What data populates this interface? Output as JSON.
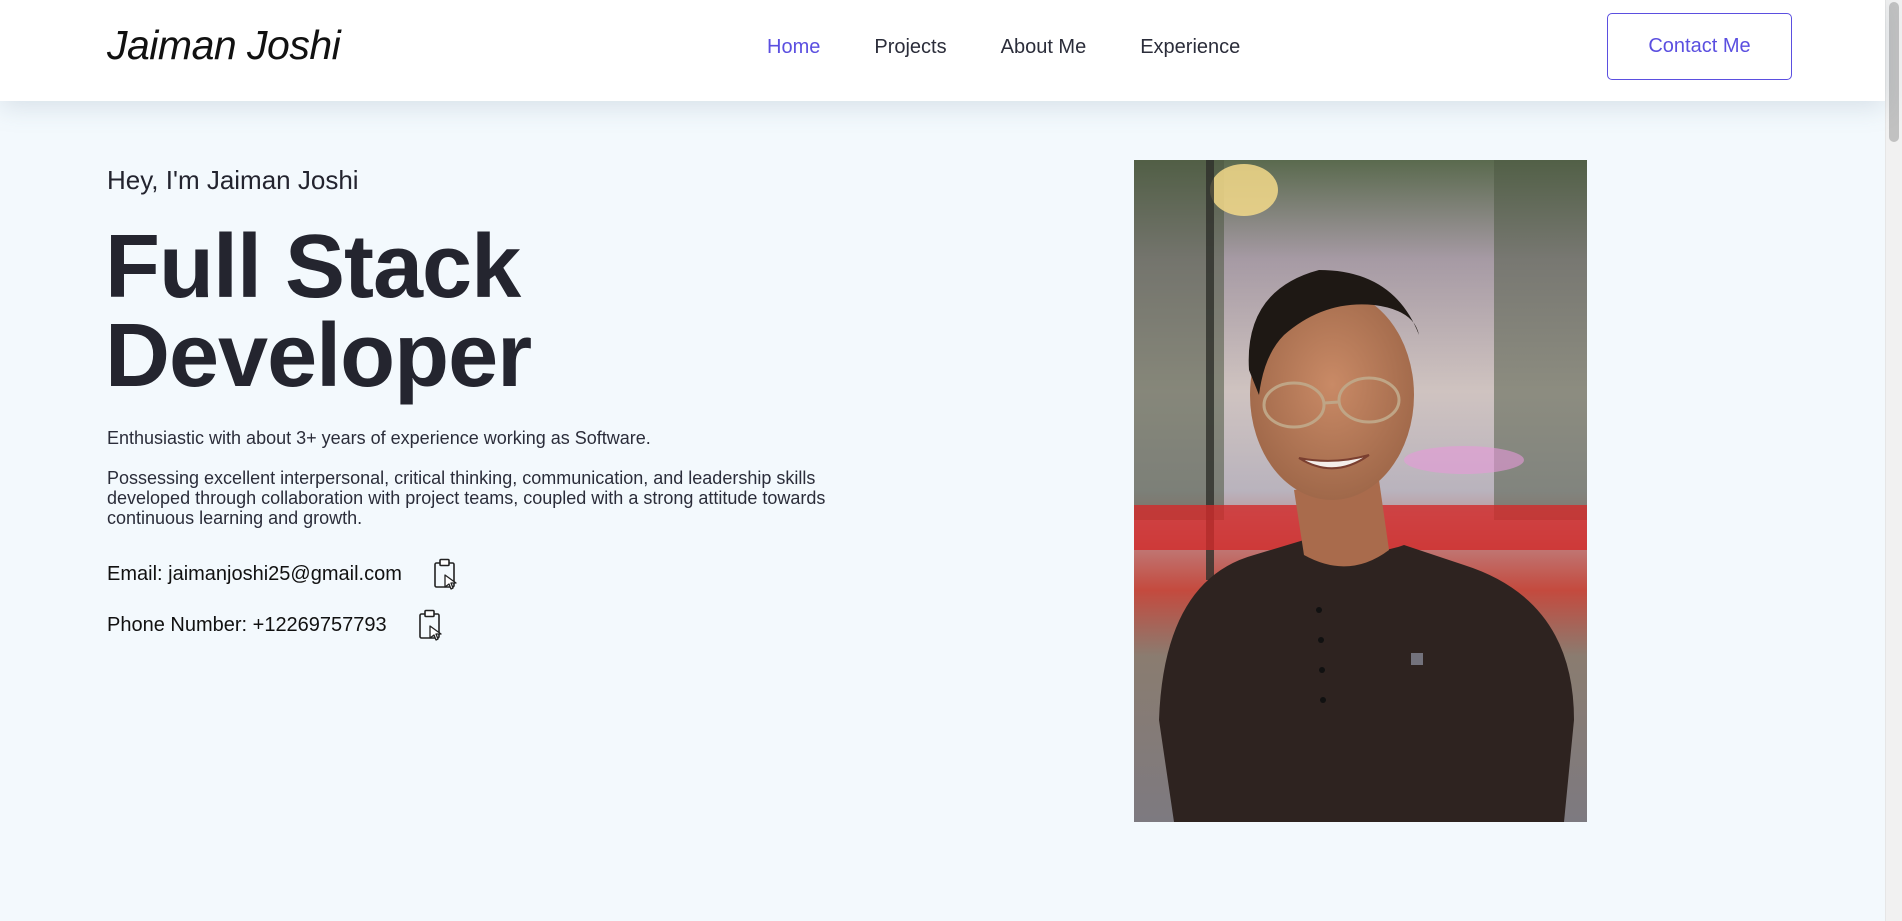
{
  "header": {
    "brand": "Jaiman Joshi",
    "nav": [
      {
        "label": "Home",
        "active": true
      },
      {
        "label": "Projects",
        "active": false
      },
      {
        "label": "About Me",
        "active": false
      },
      {
        "label": "Experience",
        "active": false
      }
    ],
    "contact_button": "Contact Me"
  },
  "hero": {
    "greeting": "Hey, I'm Jaiman Joshi",
    "role_line1": "Full Stack",
    "role_line2": "Developer",
    "intro": "Enthusiastic with about 3+ years of experience working as Software.",
    "summary": "Possessing excellent interpersonal, critical thinking, communication, and leadership skills developed through collaboration with project teams, coupled with a strong attitude towards continuous learning and growth.",
    "email_text": "Email: jaimanjoshi25@gmail.com",
    "phone_text": "Phone Number: +12269757793",
    "copy_icon": "clipboard-icon",
    "photo_icon": "profile-photo"
  },
  "colors": {
    "accent": "#5b4fe0",
    "background": "#f3f9fd",
    "text": "#23242f"
  }
}
